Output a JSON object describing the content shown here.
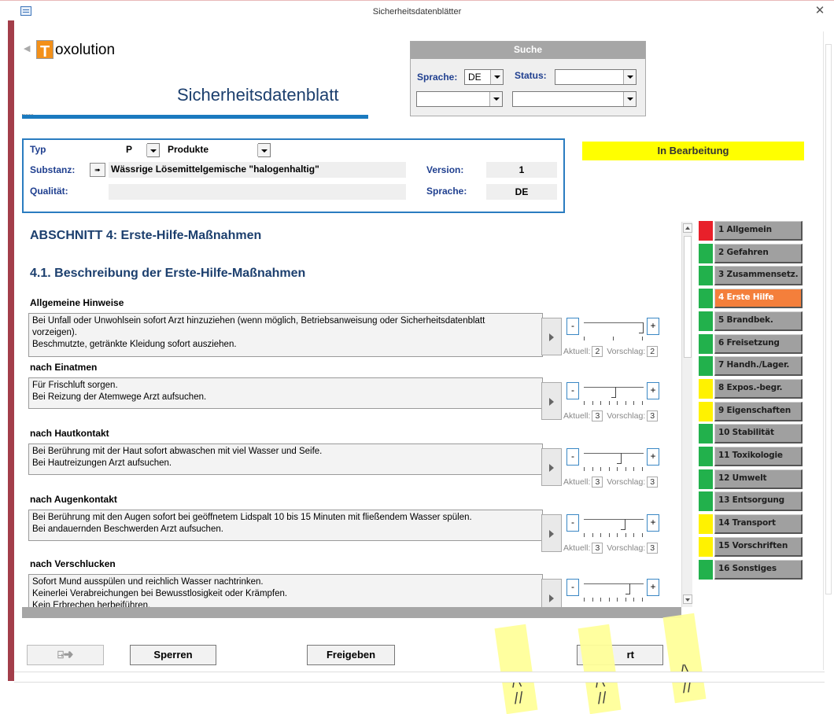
{
  "window": {
    "title": "Sicherheitsdatenblätter",
    "close_icon": "close-icon"
  },
  "header": {
    "logo_letter": "T",
    "logo_rest": "oxolution",
    "title": "Sicherheitsdatenblatt"
  },
  "search": {
    "heading": "Suche",
    "sprache_label": "Sprache:",
    "sprache_value": "DE",
    "status_label": "Status:",
    "status_value": "",
    "combo3_value": "",
    "combo4_value": ""
  },
  "info": {
    "typ_label": "Typ",
    "typ_value": "P",
    "typ_name": "Produkte",
    "substanz_label": "Substanz:",
    "substanz_value": "Wässrige Lösemittelgemische \"halogenhaltig\"",
    "qualitaet_label": "Qualität:",
    "qualitaet_value": "",
    "version_label": "Version:",
    "version_value": "1",
    "sprache_label": "Sprache:",
    "sprache_value": "DE"
  },
  "status": {
    "text": "In Bearbeitung",
    "color": "#ffff00"
  },
  "content": {
    "section_title": "ABSCHNITT 4: Erste-Hilfe-Maßnahmen",
    "subsection_title": "4.1. Beschreibung der Erste-Hilfe-Maßnahmen",
    "blocks": [
      {
        "heading": "Allgemeine Hinweise",
        "lines": [
          "Bei Unfall oder Unwohlsein sofort Arzt hinzuziehen (wenn möglich, Betriebsanweisung oder Sicherheitsdatenblatt",
          "vorzeigen).",
          "Beschmutzte, getränkte Kleidung sofort ausziehen."
        ],
        "aktuell_label": "Aktuell:",
        "aktuell": "2",
        "vorschlag_label": "Vorschlag:",
        "vorschlag": "2",
        "level": 1.0
      },
      {
        "heading": "nach Einatmen",
        "lines": [
          "Für Frischluft sorgen.",
          "Bei Reizung der Atemwege Arzt aufsuchen."
        ],
        "aktuell_label": "Aktuell:",
        "aktuell": "3",
        "vorschlag_label": "Vorschlag:",
        "vorschlag": "3",
        "level": 0.5
      },
      {
        "heading": "nach Hautkontakt",
        "lines": [
          "Bei Berührung mit der Haut sofort abwaschen mit viel Wasser und Seife.",
          "Bei Hautreizungen Arzt aufsuchen."
        ],
        "aktuell_label": "Aktuell:",
        "aktuell": "3",
        "vorschlag_label": "Vorschlag:",
        "vorschlag": "3",
        "level": 0.6
      },
      {
        "heading": "nach Augenkontakt",
        "lines": [
          "Bei Berührung mit den Augen sofort bei geöffnetem Lidspalt 10 bis 15 Minuten mit fließendem Wasser spülen.",
          "Bei andauernden Beschwerden Arzt aufsuchen."
        ],
        "aktuell_label": "Aktuell:",
        "aktuell": "3",
        "vorschlag_label": "Vorschlag:",
        "vorschlag": "3",
        "level": 0.67
      },
      {
        "heading": "nach Verschlucken",
        "lines": [
          "Sofort Mund ausspülen und reichlich Wasser nachtrinken.",
          "Keinerlei Verabreichungen bei Bewusstlosigkeit oder Krämpfen.",
          "Kein Erbrechen herbeiführen."
        ],
        "aktuell_label": "",
        "aktuell": "",
        "vorschlag_label": "",
        "vorschlag": "",
        "level": 0.75
      }
    ]
  },
  "nav": [
    {
      "label": "1 Allgemein",
      "color": "#e8202a"
    },
    {
      "label": "2 Gefahren",
      "color": "#22b14c"
    },
    {
      "label": "3 Zusammensetz.",
      "color": "#22b14c"
    },
    {
      "label": "4 Erste Hilfe",
      "color": "#22b14c",
      "active": true
    },
    {
      "label": "5 Brandbek.",
      "color": "#22b14c"
    },
    {
      "label": "6 Freisetzung",
      "color": "#22b14c"
    },
    {
      "label": "7 Handh./Lager.",
      "color": "#22b14c"
    },
    {
      "label": "8 Expos.-begr.",
      "color": "#fff200"
    },
    {
      "label": "9 Eigenschaften",
      "color": "#fff200"
    },
    {
      "label": "10 Stabilität",
      "color": "#22b14c"
    },
    {
      "label": "11 Toxikologie",
      "color": "#22b14c"
    },
    {
      "label": "12 Umwelt",
      "color": "#22b14c"
    },
    {
      "label": "13 Entsorgung",
      "color": "#22b14c"
    },
    {
      "label": "14 Transport",
      "color": "#fff200"
    },
    {
      "label": "15 Vorschriften",
      "color": "#fff200"
    },
    {
      "label": "16 Sonstiges",
      "color": "#22b14c"
    }
  ],
  "buttons": {
    "exit_icon": "exit-door-icon",
    "sperren": "Sperren",
    "freigeben": "Freigeben",
    "fourth": "rt"
  },
  "controls": {
    "minus": "-",
    "plus": "+"
  }
}
